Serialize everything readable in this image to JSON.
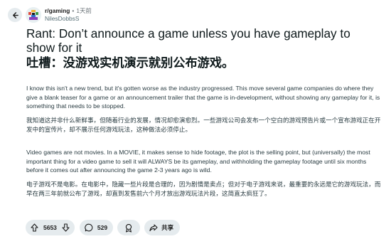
{
  "post": {
    "subreddit": "r/gaming",
    "dot": "•",
    "time": "1天前",
    "author": "NilesDobbsS",
    "title_en": "Rant: Don’t announce a game unless you have gameplay to show for it",
    "title_cn": "吐槽：没游戏实机演示就别公布游戏。",
    "body": [
      "I know this isn't a new trend, but it's gotten worse as the industry progressed. This move several game companies do where they give a blank teaser for a game or an announcement trailer that the game is in-development, without showing any gameplay for it, is something that needs to be stopped.",
      "我知道这并非什么新鲜事，但随着行业的发展，情况却愈演愈烈。一些游戏公司会发布一个空白的游戏预告片或一个宣布游戏正在开发中的宣传片，却不展示任何游戏玩法，这种做法必须停止。",
      "Video games are not movies. In a MOVIE, it makes sense to hide footage, the plot is the selling point, but (universally) the most important thing for a video game to sell it will ALWAYS be its gameplay, and withholding the gameplay footage until six months before it comes out after announcing the game 2-3 years ago is wild.",
      "电子游戏不是电影。在电影中，隐藏一些片段是合理的，因为剧情是卖点；但对于电子游戏来说，最重要的永远是它的游戏玩法，而早在两三年前就公布了游戏，却直到发售前六个月才放出游戏玩法片段，这简直太疯狂了。"
    ]
  },
  "actions": {
    "upvotes": "5653",
    "comments": "529",
    "share_label": "共享"
  },
  "colors": {
    "pill_bg": "#e5ebee",
    "body_text": "#2a3c42",
    "meta_text": "#576f76"
  },
  "icons": [
    "back-arrow-icon",
    "upvote-arrow-icon",
    "downvote-arrow-icon",
    "comment-bubble-icon",
    "award-icon",
    "share-arrow-icon"
  ]
}
